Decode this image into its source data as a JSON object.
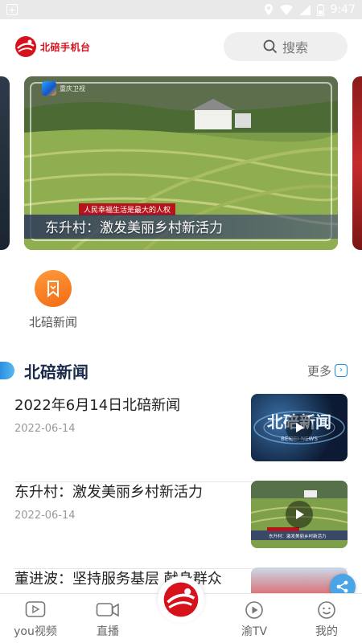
{
  "status_bar": {
    "time": "9:47"
  },
  "header": {
    "brand_name": "北碚手机台",
    "search_label": "搜索"
  },
  "carousel": {
    "slide": {
      "caption": "东升村：激发美丽乡村新活力",
      "ribbon": "人民幸福生活是最大的人权",
      "station_logo_text": "重庆卫视"
    }
  },
  "quick_entry": {
    "label": "北碚新闻"
  },
  "section": {
    "title": "北碚新闻",
    "more_label": "更多",
    "items": [
      {
        "title": "2022年6月14日北碚新闻",
        "date": "2022-06-14",
        "thumb_text": "北碚新闻",
        "thumb_sub": "BEIBEI NEWS"
      },
      {
        "title": "东升村：激发美丽乡村新活力",
        "date": "2022-06-14",
        "thumb_text": "东升村：激发美丽乡村新活力"
      },
      {
        "title": "董进波：坚持服务基层 献身群众",
        "date": ""
      }
    ]
  },
  "bottom_nav": {
    "items": [
      {
        "label": "you视频",
        "icon": "video-play-icon"
      },
      {
        "label": "直播",
        "icon": "camera-icon"
      },
      {
        "label": "",
        "icon": "brand-logo-icon"
      },
      {
        "label": "渝TV",
        "icon": "tv-play-icon"
      },
      {
        "label": "我的",
        "icon": "smiley-icon"
      }
    ]
  },
  "colors": {
    "brand_red": "#d6121c",
    "accent_blue": "#2a8fe0",
    "quick_orange": "#f26b14"
  }
}
